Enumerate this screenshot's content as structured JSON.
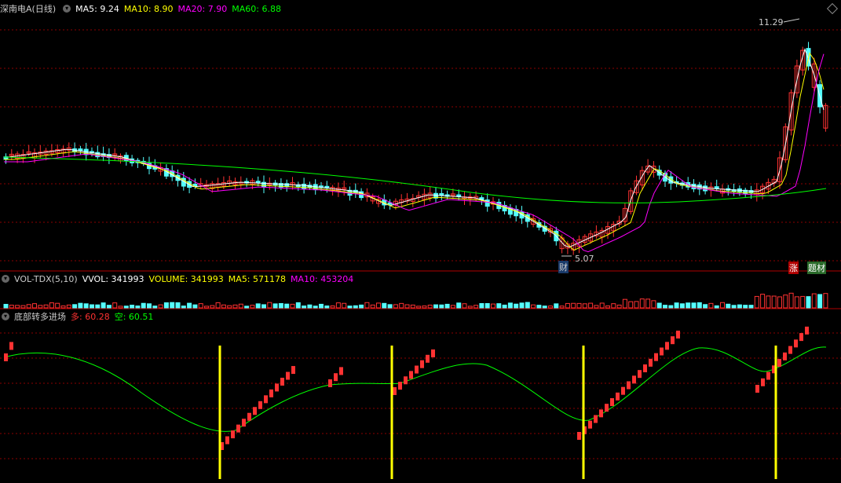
{
  "main_header": {
    "title": "深南电A(日线)",
    "ma5_label": "MA5: 9.24",
    "ma10_label": "MA10: 8.90",
    "ma20_label": "MA20: 7.90",
    "ma60_label": "MA60: 6.88"
  },
  "volume_header": {
    "title": "VOL-TDX(5,10)",
    "vvol_label": "VVOL: 341993",
    "volume_label": "VOLUME: 341993",
    "ma5_label": "MA5: 571178",
    "ma10_label": "MA10: 453204"
  },
  "indicator_header": {
    "title": "底部转多进场",
    "long_label": "多: 60.28",
    "short_label": "空: 60.51"
  },
  "annotations": {
    "high_label": "11.29",
    "low_label": "5.07",
    "finance_badge": "财",
    "limit_up_badge": "涨",
    "hot_badge": "题材"
  },
  "colors": {
    "background": "#000000",
    "up": "#ff3232",
    "down": "#54ffff",
    "ma5": "#ffffff",
    "ma10": "#ffff00",
    "ma20": "#ff00ff",
    "ma60": "#00ff00",
    "grid": "#8b0000",
    "signal_line": "#ffff00"
  }
}
